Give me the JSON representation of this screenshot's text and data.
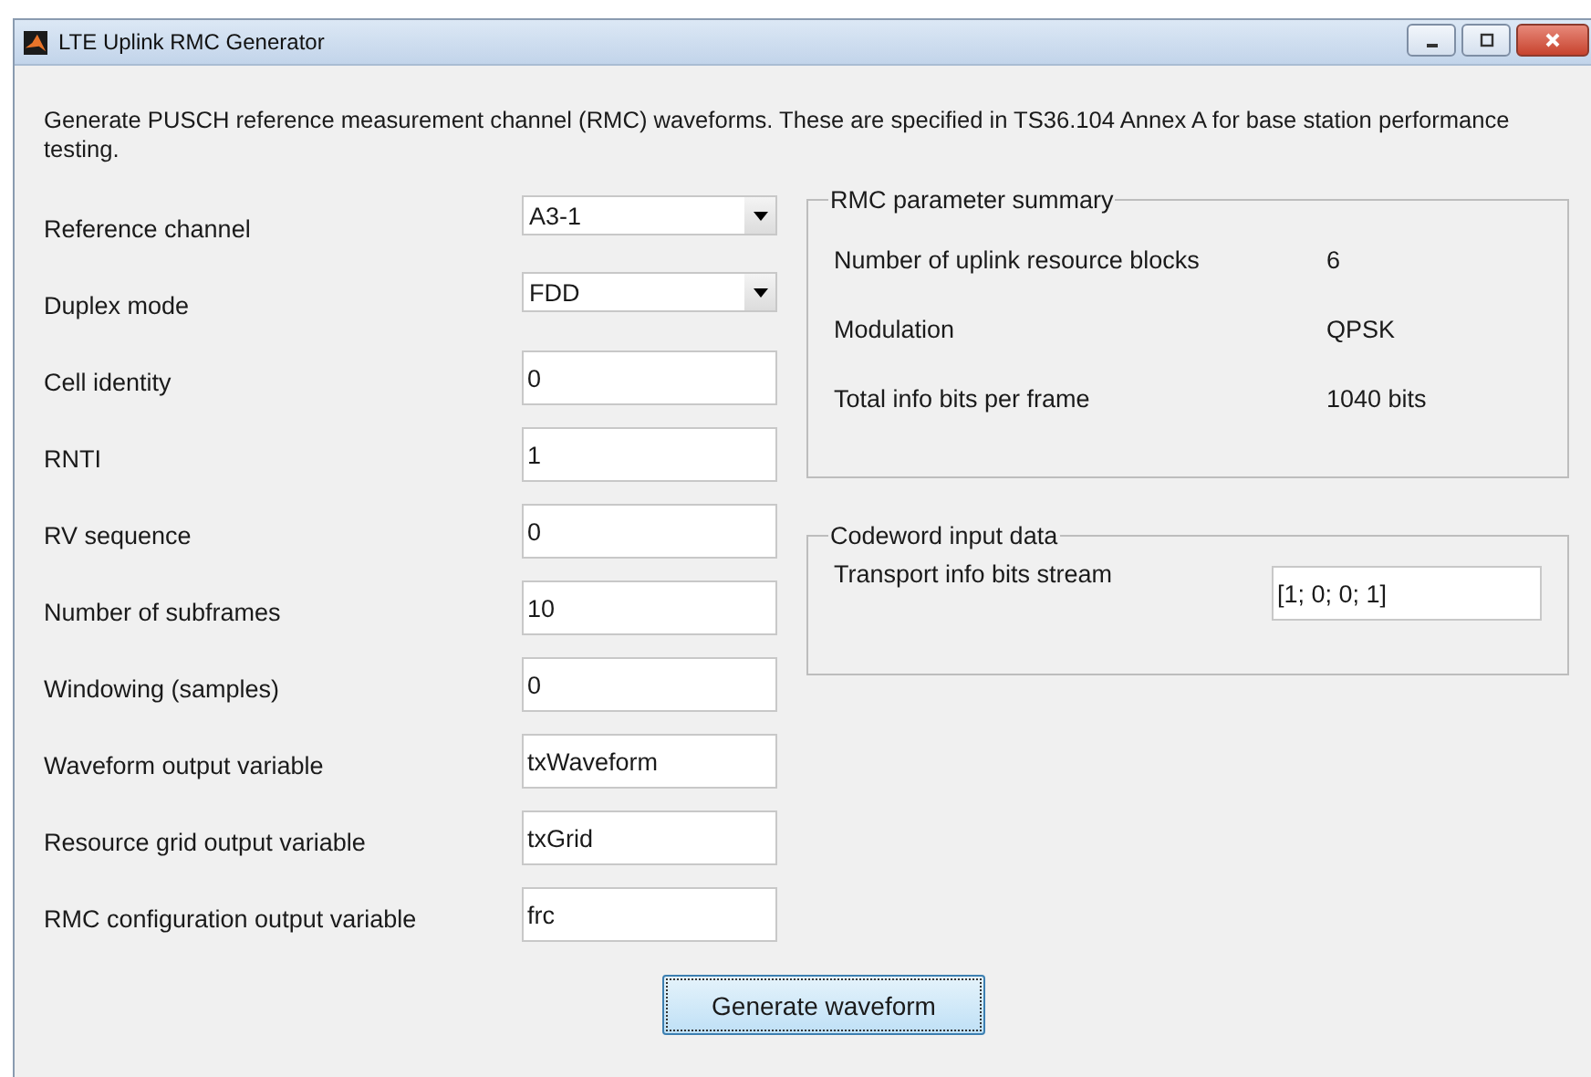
{
  "window": {
    "title": "LTE Uplink RMC Generator"
  },
  "description": "Generate PUSCH reference measurement channel (RMC) waveforms. These are specified in TS36.104 Annex A for base station performance testing.",
  "fields": [
    {
      "kind": "dropdown",
      "label": "Reference channel",
      "value": "A3-1"
    },
    {
      "kind": "dropdown",
      "label": "Duplex mode",
      "value": "FDD"
    },
    {
      "kind": "text",
      "label": "Cell identity",
      "value": "0"
    },
    {
      "kind": "text",
      "label": "RNTI",
      "value": "1"
    },
    {
      "kind": "text",
      "label": "RV sequence",
      "value": "0"
    },
    {
      "kind": "text",
      "label": "Number of subframes",
      "value": "10"
    },
    {
      "kind": "text",
      "label": "Windowing (samples)",
      "value": "0"
    },
    {
      "kind": "text",
      "label": "Waveform output variable",
      "value": "txWaveform"
    },
    {
      "kind": "text",
      "label": "Resource grid output variable",
      "value": "txGrid"
    },
    {
      "kind": "text",
      "label": "RMC configuration output variable",
      "value": "frc"
    }
  ],
  "summary": {
    "title": "RMC parameter summary",
    "rows": [
      {
        "label": "Number of uplink resource blocks",
        "value": "6"
      },
      {
        "label": "Modulation",
        "value": "QPSK"
      },
      {
        "label": "Total info bits per frame",
        "value": "1040 bits"
      }
    ]
  },
  "codeword": {
    "title": "Codeword input data",
    "label": "Transport info bits stream",
    "value": "[1; 0; 0; 1]"
  },
  "buttons": [
    "Generate waveform"
  ]
}
